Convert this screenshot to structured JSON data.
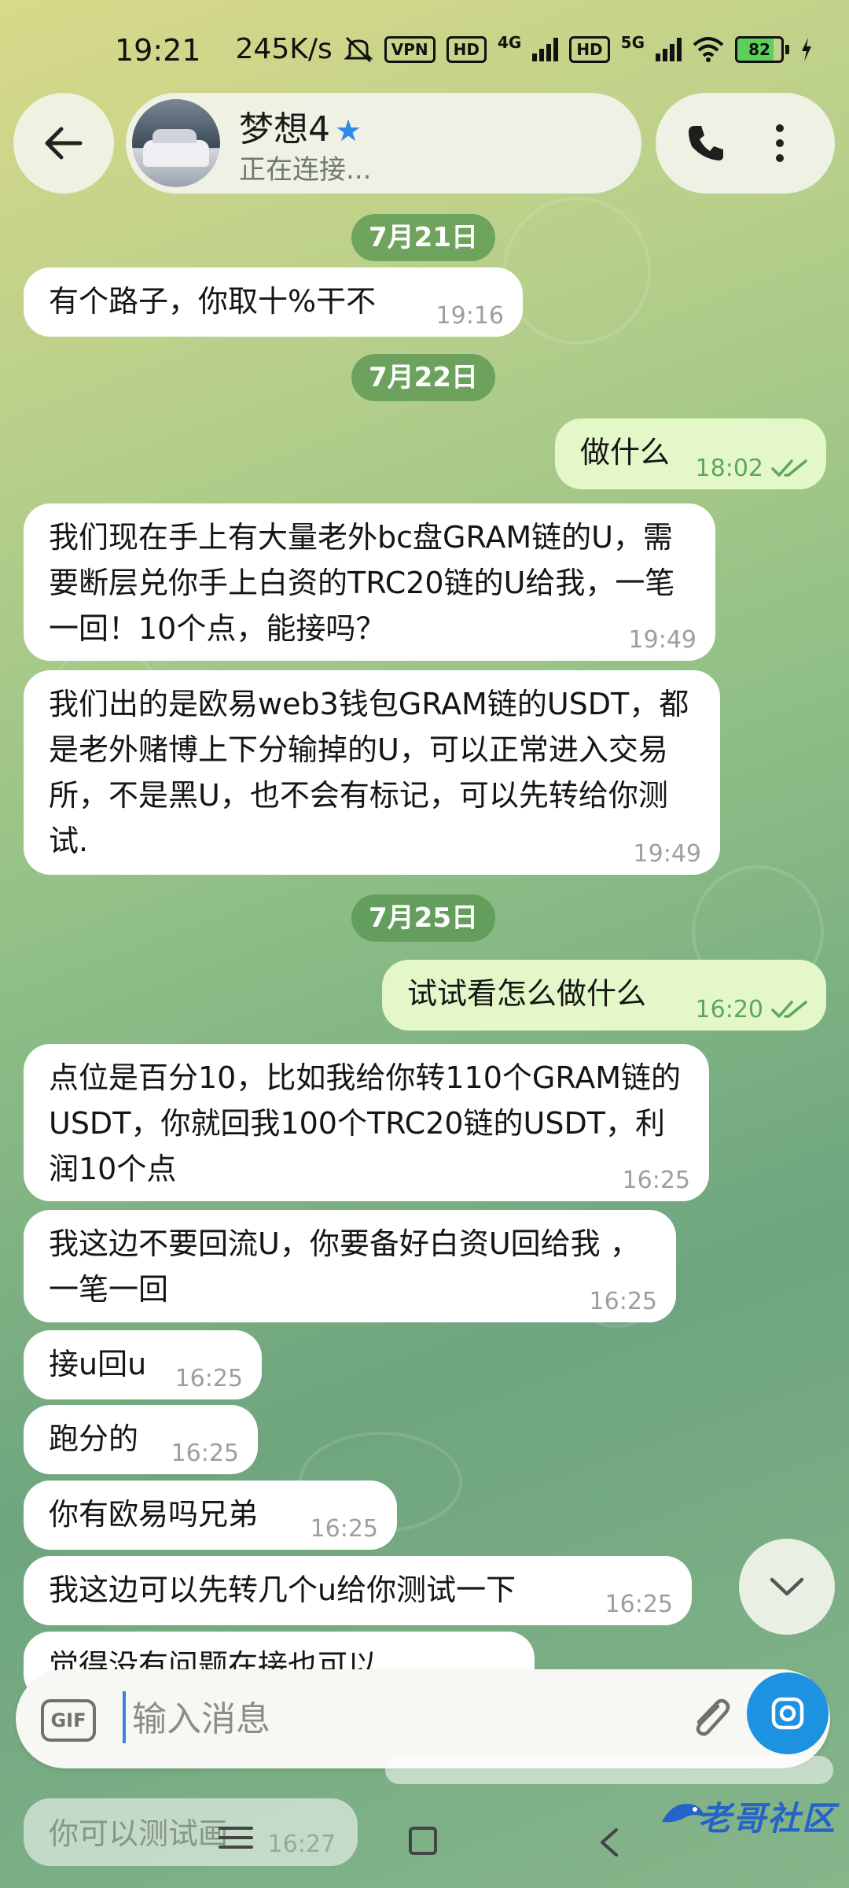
{
  "status_bar": {
    "time": "19:21",
    "speed": "245K/s",
    "vpn": "VPN",
    "hd1": "HD",
    "net1": "4G",
    "hd2": "HD",
    "net2": "5G",
    "battery": "82",
    "battery_level": 0.82
  },
  "header": {
    "contact_name": "梦想4",
    "status": "正在连接..."
  },
  "dates": [
    "7月21日",
    "7月22日",
    "7月25日"
  ],
  "messages": [
    {
      "text": "有个路子，你取十%干不",
      "time": "19:16"
    },
    {
      "text": "做什么",
      "time": "18:02"
    },
    {
      "text": "我们现在手上有大量老外bc盘GRAM链的U，需要断层兑你手上白资的TRC20链的U给我，一笔一回！10个点，能接吗？",
      "time": "19:49"
    },
    {
      "text": "我们出的是欧易web3钱包GRAM链的USDT，都是老外赌博上下分输掉的U，可以正常进入交易所，不是黑U，也不会有标记，可以先转给你测试.",
      "time": "19:49"
    },
    {
      "text": "试试看怎么做什么",
      "time": "16:20"
    },
    {
      "text": "点位是百分10，比如我给你转110个GRAM链的USDT，你就回我100个TRC20链的USDT，利润10个点",
      "time": "16:25"
    },
    {
      "text": "我这边不要回流U，你要备好白资U回给我 ，一笔一回",
      "time": "16:25"
    },
    {
      "text": "接u回u",
      "time": "16:25"
    },
    {
      "text": "跑分的",
      "time": "16:25"
    },
    {
      "text": "你有欧易吗兄弟",
      "time": "16:25"
    },
    {
      "text": "我这边可以先转几个u给你测试一下",
      "time": "16:25"
    },
    {
      "text": "觉得没有问题在接也可以",
      "time": ""
    }
  ],
  "input": {
    "gif_label": "GIF",
    "placeholder": "输入消息"
  },
  "hidden_message": {
    "text": "你可以测试画",
    "time": "16:27"
  },
  "watermark": "老哥社区",
  "colors": {
    "incoming_bubble": "#ffffff",
    "outgoing_bubble": "#e3f7c8",
    "date_chip": "#5e9a57",
    "accent": "#1d92e0",
    "star": "#2f8ae5"
  }
}
